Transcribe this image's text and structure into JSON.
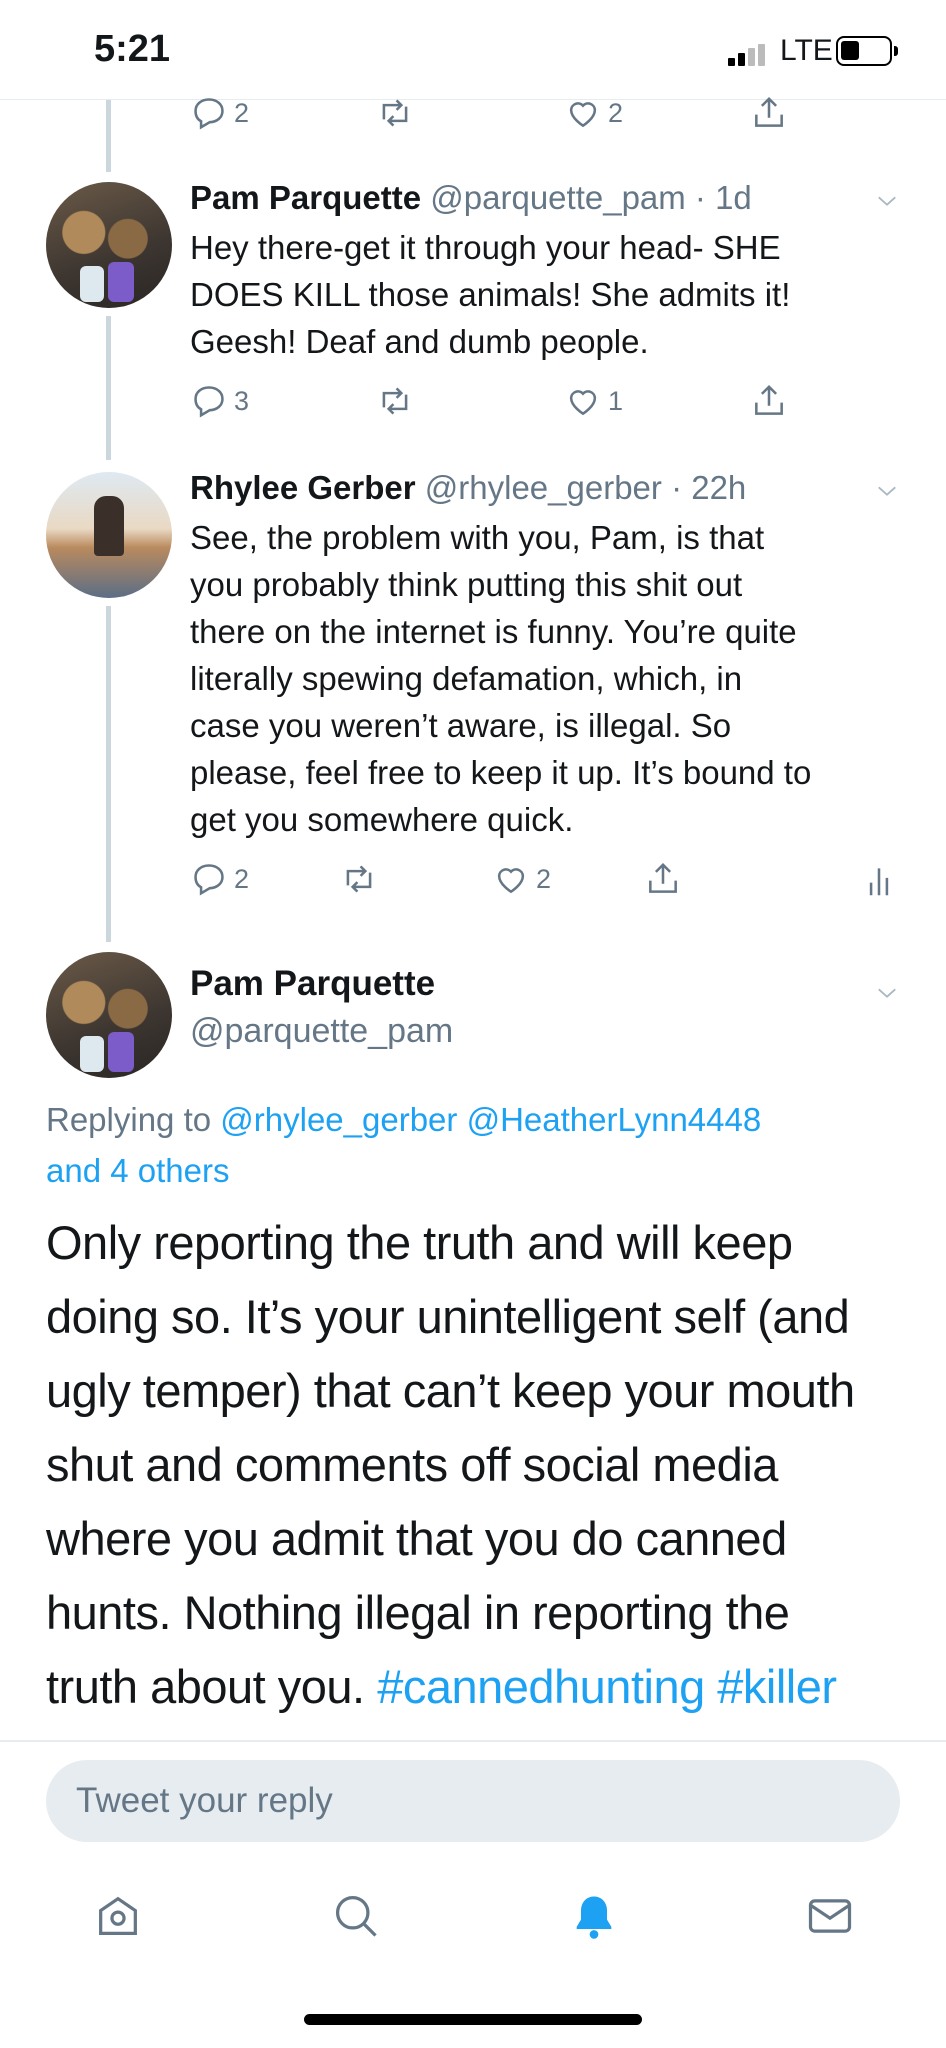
{
  "status_bar": {
    "time": "5:21",
    "network": "LTE"
  },
  "previous_actions": {
    "replies": "2",
    "likes": "2"
  },
  "tweets": [
    {
      "name": "Pam Parquette",
      "meta": "@parquette_pam · 1d",
      "lines": [
        "Hey there-get it through your head- SHE",
        "DOES KILL those animals! She admits it!",
        "Geesh! Deaf and dumb people."
      ],
      "replies": "3",
      "likes": "1"
    },
    {
      "name": "Rhylee Gerber",
      "meta": "@rhylee_gerber · 22h",
      "lines": [
        "See, the problem with you, Pam, is that",
        "you probably think putting this shit out",
        "there on the internet is funny. You’re quite",
        "literally spewing defamation, which, in",
        "case you weren’t aware, is illegal. So",
        "please, feel free to keep it up. It’s bound to",
        "get you somewhere quick."
      ],
      "replies": "2",
      "likes": "2"
    }
  ],
  "focus_tweet": {
    "name": "Pam Parquette",
    "handle": "@parquette_pam",
    "replying_prefix": "Replying to",
    "replying_users": "@rhylee_gerber @HeatherLynn4448",
    "replying_others": "and 4 others",
    "lines": [
      "Only reporting the truth and will keep",
      "doing so. It’s your unintelligent self (and",
      "ugly temper) that can’t keep your mouth",
      "shut and comments off social media",
      "where you admit that you do canned",
      "hunts. Nothing illegal in reporting the"
    ],
    "last_line": "truth about you.",
    "hashtag1": "#cannedhunting",
    "hashtag2": "#killer"
  },
  "reply_box": {
    "placeholder": "Tweet your reply"
  },
  "tab_bar": {
    "icons": [
      "home-icon",
      "search-icon",
      "notifications-icon",
      "messages-icon"
    ],
    "active": "notifications-icon"
  },
  "colors": {
    "accent": "#1da1f2",
    "muted": "#657786",
    "divider": "#e6ecf0"
  }
}
